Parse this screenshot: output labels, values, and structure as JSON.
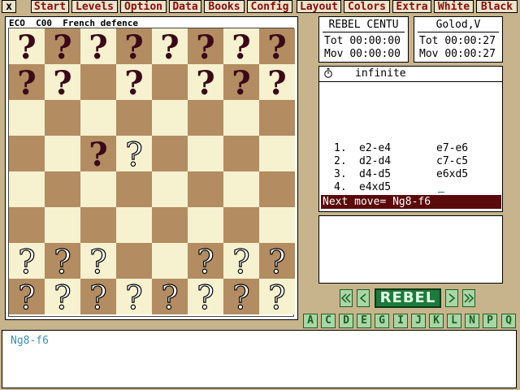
{
  "menu": {
    "close_label": "x",
    "items": [
      "Start",
      "Levels",
      "Option",
      "Data",
      "Books",
      "Config",
      "Layout",
      "Colors",
      "Extra",
      "White",
      "Black"
    ]
  },
  "board": {
    "title": "ECO  C00  French defence",
    "piece_glyph": "?",
    "ranks": [
      [
        "b",
        "b",
        "b",
        "b",
        "b",
        "b",
        "b",
        "b"
      ],
      [
        "b",
        "b",
        "",
        "b",
        "",
        "b",
        "b",
        "b"
      ],
      [
        "",
        "",
        "",
        "",
        "",
        "",
        "",
        ""
      ],
      [
        "",
        "",
        "b",
        "w",
        "",
        "",
        "",
        ""
      ],
      [
        "",
        "",
        "",
        "",
        "",
        "",
        "",
        ""
      ],
      [
        "",
        "",
        "",
        "",
        "",
        "",
        "",
        ""
      ],
      [
        "w",
        "w",
        "w",
        "",
        "",
        "w",
        "w",
        "w"
      ],
      [
        "w",
        "w",
        "w",
        "w",
        "w",
        "w",
        "w",
        "w"
      ]
    ]
  },
  "clocks": {
    "left": {
      "name": "REBEL CENTU",
      "tot_label": "Tot",
      "tot": "00:00:00",
      "mov_label": "Mov",
      "mov": "00:00:00"
    },
    "right": {
      "name": "Golod,V",
      "tot_label": "Tot",
      "tot": "00:00:27",
      "mov_label": "Mov",
      "mov": "00:00:27"
    }
  },
  "moves_panel": {
    "header": "infinite",
    "header_icon": "stopwatch-icon",
    "moves": [
      {
        "num": "1.",
        "white": "e2-e4",
        "black": "e7-e6"
      },
      {
        "num": "2.",
        "white": "d2-d4",
        "black": "c7-c5"
      },
      {
        "num": "3.",
        "white": "d4-d5",
        "black": "e6xd5"
      },
      {
        "num": "4.",
        "white": "e4xd5",
        "black": ""
      }
    ],
    "next_move": "Next move= Ng8-f6"
  },
  "nav": {
    "first": "first-icon",
    "prev": "prev-icon",
    "brand": "REBEL",
    "next": "next-icon",
    "last": "last-icon"
  },
  "letters": [
    "A",
    "C",
    "D",
    "E",
    "G",
    "I",
    "J",
    "K",
    "L",
    "N",
    "P",
    "Q"
  ],
  "bottom_text": "Ng8-f6",
  "colors": {
    "background": "#c8b48c",
    "menu_text": "#8a0c0c",
    "light_square": "#f6f1cf",
    "dark_square": "#b38c62",
    "black_piece": "#3a0818",
    "next_move_bg": "#5a0a0a",
    "rebel_green": "#1d7a3c",
    "bottom_text": "#3a8eb0"
  }
}
